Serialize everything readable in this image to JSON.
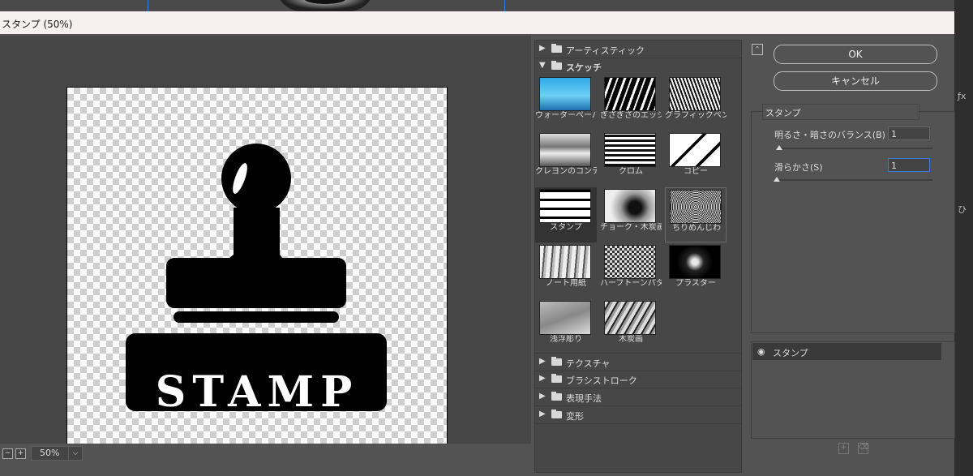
{
  "window": {
    "title": "スタンプ (50%)"
  },
  "preview": {
    "zoom": "50%",
    "stamp_text": "STAMP"
  },
  "browser": {
    "categories_top": [
      {
        "label": "アーティスティック",
        "expanded": false
      },
      {
        "label": "スケッチ",
        "expanded": true
      }
    ],
    "filters": [
      {
        "label": "ウォーターペーパー"
      },
      {
        "label": "ぎざぎざのエッジ"
      },
      {
        "label": "グラフィックペン"
      },
      {
        "label": "クレヨンのコンテ画"
      },
      {
        "label": "クロム"
      },
      {
        "label": "コピー"
      },
      {
        "label": "スタンプ",
        "selected": true
      },
      {
        "label": "チョーク・木炭画"
      },
      {
        "label": "ちりめんじわ"
      },
      {
        "label": "ノート用紙"
      },
      {
        "label": "ハーフトーンパターン"
      },
      {
        "label": "プラスター"
      },
      {
        "label": "浅浮彫り"
      },
      {
        "label": "木炭画"
      }
    ],
    "categories_bottom": [
      {
        "label": "テクスチャ"
      },
      {
        "label": "ブラシストローク"
      },
      {
        "label": "表現手法"
      },
      {
        "label": "変形"
      }
    ]
  },
  "options": {
    "ok_label": "OK",
    "cancel_label": "キャンセル",
    "filter_select": "スタンプ",
    "params": [
      {
        "label": "明るさ・暗さのバランス(B)",
        "value": "1",
        "slider": 0.02
      },
      {
        "label": "滑らかさ(S)",
        "value": "1",
        "slider": 0.0
      }
    ]
  },
  "layers": {
    "items": [
      {
        "label": "スタンプ",
        "visible": true
      }
    ]
  },
  "colors": {
    "accent": "#3a7bd5",
    "panel": "#535353",
    "dark": "#474747"
  },
  "icons": [
    "eye-icon",
    "folder-icon",
    "new-layer-icon",
    "trash-icon",
    "collapse-icon",
    "chevron-down-icon"
  ]
}
